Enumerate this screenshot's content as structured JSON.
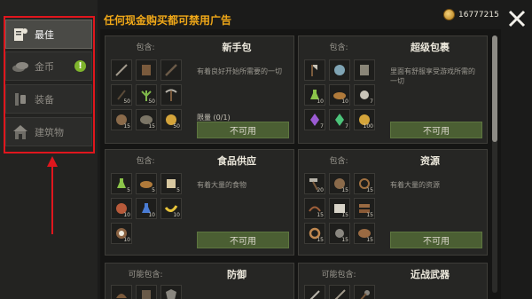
{
  "sidebar": {
    "items": [
      {
        "label": "最佳",
        "icon": "merchant-icon",
        "active": true
      },
      {
        "label": "金币",
        "icon": "coins-icon",
        "badge": "!"
      },
      {
        "label": "装备",
        "icon": "equipment-icon"
      },
      {
        "label": "建筑物",
        "icon": "house-icon"
      }
    ]
  },
  "header": {
    "title": "任何现金购买都可禁用广告",
    "coins": "16777215"
  },
  "cards": [
    {
      "contains": "包含:",
      "title": "新手包",
      "desc": "有着良好开始所需要的一切",
      "limit": "限量 (0/1)",
      "button": "不可用",
      "slots": [
        {
          "icon": "spear-icon",
          "count": ""
        },
        {
          "icon": "leather-armor-icon",
          "count": ""
        },
        {
          "icon": "staff-icon",
          "count": ""
        },
        {
          "icon": "stick-icon",
          "count": "50"
        },
        {
          "icon": "plant-fiber-icon",
          "count": "50"
        },
        {
          "icon": "pickaxe-icon",
          "count": ""
        },
        {
          "icon": "ore-icon",
          "count": "15"
        },
        {
          "icon": "hide-icon",
          "count": "15"
        },
        {
          "icon": "coin-icon",
          "count": "50"
        }
      ]
    },
    {
      "contains": "包含:",
      "title": "超级包裹",
      "desc": "里面有舒服享受游戏所需的一切",
      "limit": "",
      "button": "不可用",
      "slots": [
        {
          "icon": "axe-icon",
          "count": ""
        },
        {
          "icon": "iron-ore-icon",
          "count": ""
        },
        {
          "icon": "chest-armor-icon",
          "count": ""
        },
        {
          "icon": "potion-icon",
          "count": "10"
        },
        {
          "icon": "bread-icon",
          "count": "10"
        },
        {
          "icon": "stone-icon",
          "count": "7"
        },
        {
          "icon": "crystal-purple-icon",
          "count": "7"
        },
        {
          "icon": "crystal-green-icon",
          "count": "7"
        },
        {
          "icon": "coin-icon",
          "count": "100"
        }
      ]
    },
    {
      "contains": "包含:",
      "title": "食品供应",
      "desc": "有着大量的食物",
      "limit": "",
      "button": "不可用",
      "slots": [
        {
          "icon": "potion-icon",
          "count": "5"
        },
        {
          "icon": "bread-icon",
          "count": "5"
        },
        {
          "icon": "scroll-icon",
          "count": "5"
        },
        {
          "icon": "meat-icon",
          "count": "10"
        },
        {
          "icon": "blue-potion-icon",
          "count": "10"
        },
        {
          "icon": "banana-icon",
          "count": "10"
        },
        {
          "icon": "coconut-icon",
          "count": "10"
        }
      ]
    },
    {
      "contains": "包含:",
      "title": "资源",
      "desc": "有着大量的资源",
      "limit": "",
      "button": "不可用",
      "slots": [
        {
          "icon": "hammer-icon",
          "count": "20"
        },
        {
          "icon": "ore-icon",
          "count": "15"
        },
        {
          "icon": "rope-icon",
          "count": "15"
        },
        {
          "icon": "vine-icon",
          "count": "15"
        },
        {
          "icon": "cloth-icon",
          "count": "15"
        },
        {
          "icon": "planks-icon",
          "count": "15"
        },
        {
          "icon": "rope-coil-icon",
          "count": "15"
        },
        {
          "icon": "stone-icon",
          "count": "15"
        },
        {
          "icon": "hide-icon",
          "count": "15"
        }
      ]
    },
    {
      "contains": "可能包含:",
      "title": "防御",
      "desc": "",
      "limit": "",
      "button": "",
      "slots": []
    },
    {
      "contains": "可能包含:",
      "title": "近战武器",
      "desc": "",
      "limit": "",
      "button": "",
      "slots": []
    }
  ],
  "colors": {
    "accent": "#f0a818",
    "highlight": "#e0161d",
    "button": "#4b5f33",
    "badge": "#7fb52c"
  }
}
